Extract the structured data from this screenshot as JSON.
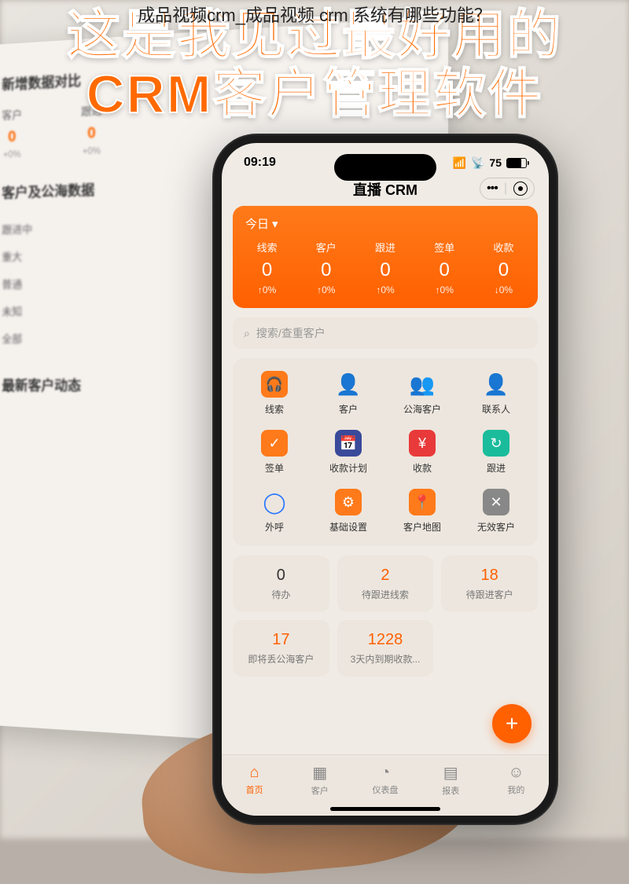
{
  "caption": "成品视频crm_成品视频 crm 系统有哪些功能？",
  "headline_l1": "这是我见过最好用的",
  "headline_l2": "CRM客户管理软件",
  "bg": {
    "section1_title": "新增数据对比",
    "cols": [
      {
        "label": "客户",
        "value": "0",
        "pct": "+0%"
      },
      {
        "label": "跟进",
        "value": "0",
        "pct": "+0%"
      }
    ],
    "section2_title": "客户及公海数据",
    "list": [
      "跟进中",
      "重大",
      "普通",
      "未知",
      "全部"
    ],
    "section3_title": "最新客户动态"
  },
  "status": {
    "time": "09:19",
    "battery": "75"
  },
  "titlebar": "直播 CRM",
  "today": {
    "label": "今日",
    "stats": [
      {
        "label": "线索",
        "value": "0",
        "delta": "↑0%"
      },
      {
        "label": "客户",
        "value": "0",
        "delta": "↑0%"
      },
      {
        "label": "跟进",
        "value": "0",
        "delta": "↑0%"
      },
      {
        "label": "签单",
        "value": "0",
        "delta": "↑0%"
      },
      {
        "label": "收款",
        "value": "0",
        "delta": "↓0%"
      }
    ]
  },
  "search_placeholder": "搜索/查重客户",
  "grid": [
    {
      "label": "线索",
      "icon": "🎧",
      "cls": "c-orange"
    },
    {
      "label": "客户",
      "icon": "👤",
      "cls": "c-orange-person"
    },
    {
      "label": "公海客户",
      "icon": "👥",
      "cls": "c-blue-icon"
    },
    {
      "label": "联系人",
      "icon": "👤",
      "cls": "c-blue-icon"
    },
    {
      "label": "签单",
      "icon": "✓",
      "cls": "c-orange"
    },
    {
      "label": "收款计划",
      "icon": "📅",
      "cls": "c-darkblue"
    },
    {
      "label": "收款",
      "icon": "¥",
      "cls": "c-red"
    },
    {
      "label": "跟进",
      "icon": "↻",
      "cls": "c-teal"
    },
    {
      "label": "外呼",
      "icon": "◯",
      "cls": "c-blue-icon"
    },
    {
      "label": "基础设置",
      "icon": "⚙",
      "cls": "c-orange"
    },
    {
      "label": "客户地图",
      "icon": "📍",
      "cls": "c-orange"
    },
    {
      "label": "无效客户",
      "icon": "✕",
      "cls": "c-gray"
    }
  ],
  "tiles": [
    {
      "num": "0",
      "label": "待办",
      "ncls": "n-black"
    },
    {
      "num": "2",
      "label": "待跟进线索",
      "ncls": "n-orange"
    },
    {
      "num": "18",
      "label": "待跟进客户",
      "ncls": "n-orange"
    },
    {
      "num": "17",
      "label": "即将丢公海客户",
      "ncls": "n-orange"
    },
    {
      "num": "1228",
      "label": "3天内到期收款...",
      "ncls": "n-orange"
    }
  ],
  "tabs": [
    {
      "label": "首页",
      "icon": "⌂",
      "active": true
    },
    {
      "label": "客户",
      "icon": "▦",
      "active": false
    },
    {
      "label": "仪表盘",
      "icon": "◔",
      "active": false
    },
    {
      "label": "报表",
      "icon": "▤",
      "active": false
    },
    {
      "label": "我的",
      "icon": "☺",
      "active": false
    }
  ]
}
